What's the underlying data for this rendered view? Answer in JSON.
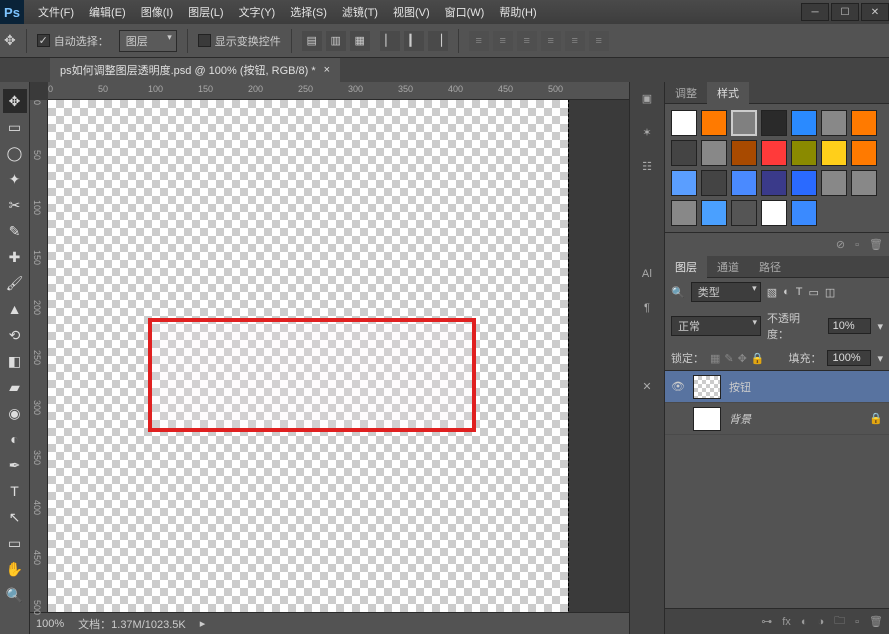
{
  "menus": [
    "文件(F)",
    "编辑(E)",
    "图像(I)",
    "图层(L)",
    "文字(Y)",
    "选择(S)",
    "滤镜(T)",
    "视图(V)",
    "窗口(W)",
    "帮助(H)"
  ],
  "options": {
    "auto_select": "自动选择：",
    "target": "图层",
    "show_transform": "显示变换控件"
  },
  "doc_tab": "ps如何调整图层透明度.psd @ 100% (按钮, RGB/8) *",
  "ruler_h": [
    "0",
    "50",
    "100",
    "150",
    "200",
    "250",
    "300",
    "350",
    "400",
    "450",
    "500"
  ],
  "ruler_v": [
    "0",
    "50",
    "100",
    "150",
    "200",
    "250",
    "300",
    "350",
    "400",
    "450",
    "500"
  ],
  "status": {
    "zoom": "100%",
    "doc": "文档：1.37M/1023.5K"
  },
  "panels": {
    "adjust_tab": "调整",
    "styles_tab": "样式",
    "layers_tab": "图层",
    "channels_tab": "通道",
    "paths_tab": "路径",
    "kind_label": "类型",
    "blend_mode": "正常",
    "opacity_label": "不透明度：",
    "opacity_value": "10%",
    "lock_label": "锁定：",
    "fill_label": "填充：",
    "fill_value": "100%"
  },
  "layers": [
    {
      "name": "按钮",
      "visible": true
    },
    {
      "name": "背景",
      "visible": false
    }
  ],
  "swatches": [
    "#fff",
    "#ff7a00",
    "#808080",
    "#2a2a2a",
    "#2a8aff",
    "#888",
    "#ff7a00",
    "#444",
    "#888",
    "#a84a00",
    "#ff3a3a",
    "#8a8a00",
    "#ffcf1a",
    "#ff7a00",
    "#5a9eff",
    "#444",
    "#4a8aff",
    "#3a3a8a",
    "#2a6aff",
    "#888",
    "#888",
    "#888",
    "#4aa0ff",
    "#555",
    "#fff",
    "#3a8aff"
  ]
}
